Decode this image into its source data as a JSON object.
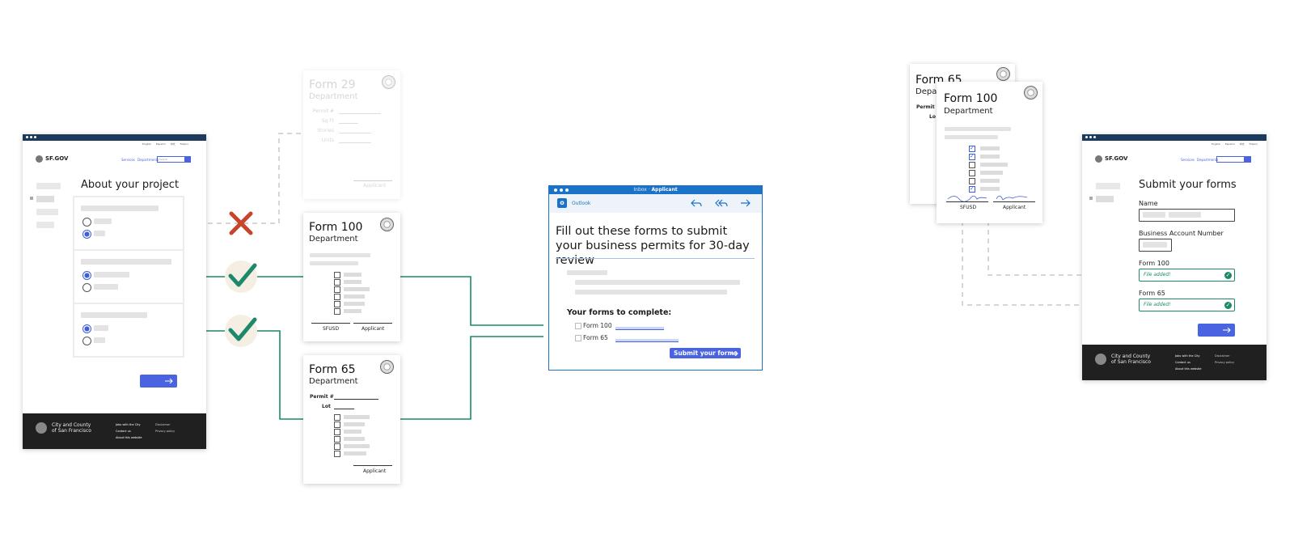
{
  "left_site": {
    "logo": "SF.GOV",
    "top_links": [
      "English",
      "Español",
      "中文",
      "Filipino"
    ],
    "nav": [
      "Services",
      "Departments"
    ],
    "search_placeholder": "Search",
    "heading": "About your project",
    "footer_name_line1": "City and County",
    "footer_name_line2": "of San Francisco",
    "footer_links": [
      "Jobs with the City",
      "Contact us",
      "About this website"
    ],
    "footer_links2": [
      "Disclaimer",
      "Privacy policy"
    ]
  },
  "form29": {
    "title": "Form 29",
    "dept": "Department",
    "fields": [
      "Permit #",
      "Sq Ft",
      "Stories",
      "Units"
    ],
    "sig": "Applicant"
  },
  "form100": {
    "title": "Form 100",
    "dept": "Department",
    "sig1": "SFUSD",
    "sig2": "Applicant"
  },
  "form65": {
    "title": "Form 65",
    "dept": "Department",
    "permit": "Permit #",
    "lot": "Lot",
    "sig": "Applicant"
  },
  "email": {
    "title_prefix": "Inbox · ",
    "title_strong": "Applicant",
    "app_name": "Outlook",
    "headline": "Fill out these forms to submit your business permits for 30-day review",
    "forms_heading": "Your forms to complete:",
    "form_items": [
      "Form 100",
      "Form 65"
    ],
    "submit_label": "Submit your forms"
  },
  "signed": {
    "back_title": "Form 65",
    "back_dept": "Depa",
    "back_permit": "Permit #",
    "back_lot": "Lo",
    "front_title": "Form 100",
    "front_dept": "Department",
    "sig1": "SFUSD",
    "sig2": "Applicant"
  },
  "right_site": {
    "logo": "SF.GOV",
    "top_links": [
      "English",
      "Español",
      "中文",
      "Filipino"
    ],
    "nav": [
      "Services",
      "Departments"
    ],
    "heading": "Submit your forms",
    "name_label": "Name",
    "ban_label": "Business Account Number",
    "form100_label": "Form 100",
    "form100_value": "File added!",
    "form65_label": "Form 65",
    "form65_value": "File added!",
    "footer_name_line1": "City and County",
    "footer_name_line2": "of San Francisco",
    "footer_links": [
      "Jobs with the City",
      "Contact us",
      "About this website"
    ],
    "footer_links2": [
      "Disclaimer",
      "Privacy policy"
    ]
  },
  "colors": {
    "accent_blue": "#4a63e0",
    "navy_bar": "#1d3a5c",
    "connector_green": "#1c8a6a",
    "reject_red": "#c8452c",
    "footer_dark": "#202020"
  },
  "icons": [
    "cross-icon",
    "checkmark-icon",
    "seal-icon",
    "arrow-right-icon",
    "reply-icon",
    "reply-all-icon",
    "forward-icon",
    "outlook-icon"
  ]
}
